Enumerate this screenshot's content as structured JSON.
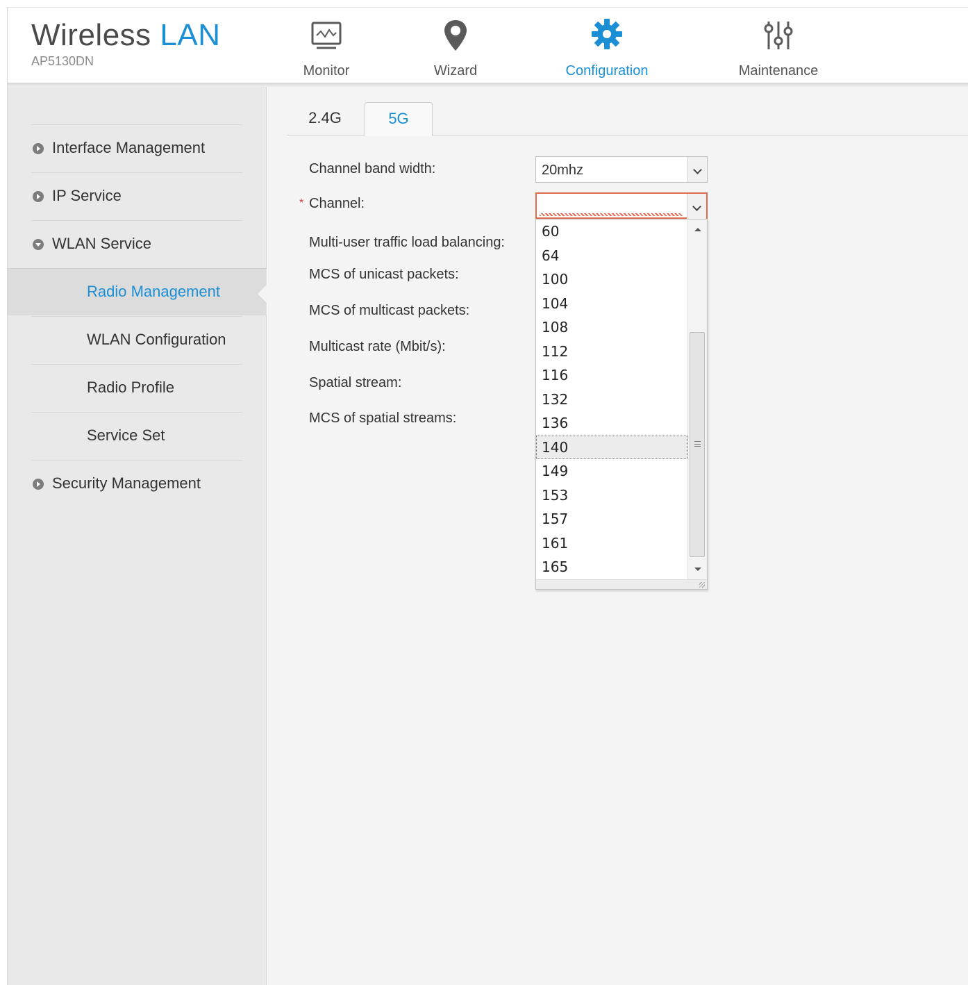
{
  "brand": {
    "title_main": "Wireless",
    "title_accent": "LAN",
    "model": "AP5130DN"
  },
  "nav": {
    "monitor": "Monitor",
    "wizard": "Wizard",
    "configuration": "Configuration",
    "maintenance": "Maintenance"
  },
  "sidebar": {
    "items": [
      {
        "label": "Interface Management"
      },
      {
        "label": "IP Service"
      },
      {
        "label": "WLAN Service"
      },
      {
        "label": "Radio Management"
      },
      {
        "label": "WLAN Configuration"
      },
      {
        "label": "Radio Profile"
      },
      {
        "label": "Service Set"
      },
      {
        "label": "Security Management"
      }
    ]
  },
  "tabs": {
    "tab_24g": "2.4G",
    "tab_5g": "5G"
  },
  "form": {
    "channel_band_width_label": "Channel band width:",
    "channel_band_width_value": "20mhz",
    "required_mark": "*",
    "channel_label": "Channel:",
    "channel_value": "",
    "multi_user_label": "Multi-user traffic load balancing:",
    "mcs_unicast_label": "MCS of unicast packets:",
    "mcs_multicast_label": "MCS of multicast packets:",
    "multicast_rate_label": "Multicast rate (Mbit/s):",
    "spatial_stream_label": "Spatial stream:",
    "mcs_spatial_label": "MCS of spatial streams:"
  },
  "channel_dropdown": {
    "options": [
      "60",
      "64",
      "100",
      "104",
      "108",
      "112",
      "116",
      "132",
      "136",
      "140",
      "149",
      "153",
      "157",
      "161",
      "165"
    ],
    "highlighted": "140"
  },
  "colors": {
    "accent": "#1a8fd6",
    "required": "#e03a3a",
    "error_border": "#e06a4e"
  }
}
